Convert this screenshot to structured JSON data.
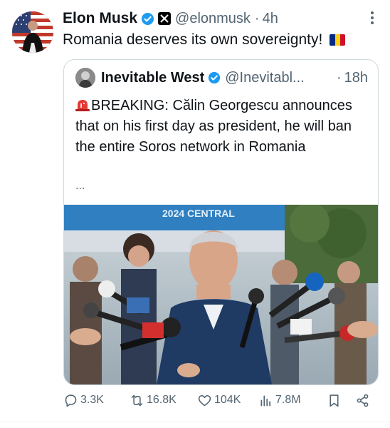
{
  "tweet": {
    "author_name": "Elon Musk",
    "handle": "@elonmusk",
    "separator": "·",
    "time": "4h",
    "text": "Romania deserves its own sovereignty!",
    "flag_emoji": "romania-flag",
    "verified_badge_color": "#1d9bf0"
  },
  "quote": {
    "author_name": "Inevitable West",
    "handle": "@Inevitabl...",
    "separator": "·",
    "time": "18h",
    "body": "BREAKING: Călin Georgescu announces that on his first day as president, he will ban the entire Soros network in Romania",
    "ellipsis": "...",
    "image_banner_text": "2024 CENTRAL"
  },
  "actions": {
    "replies": "3.3K",
    "reposts": "16.8K",
    "likes": "104K",
    "views": "7.8M"
  },
  "colors": {
    "text_primary": "#0f1419",
    "text_secondary": "#536471",
    "border": "#cfd9de",
    "accent": "#1d9bf0"
  }
}
